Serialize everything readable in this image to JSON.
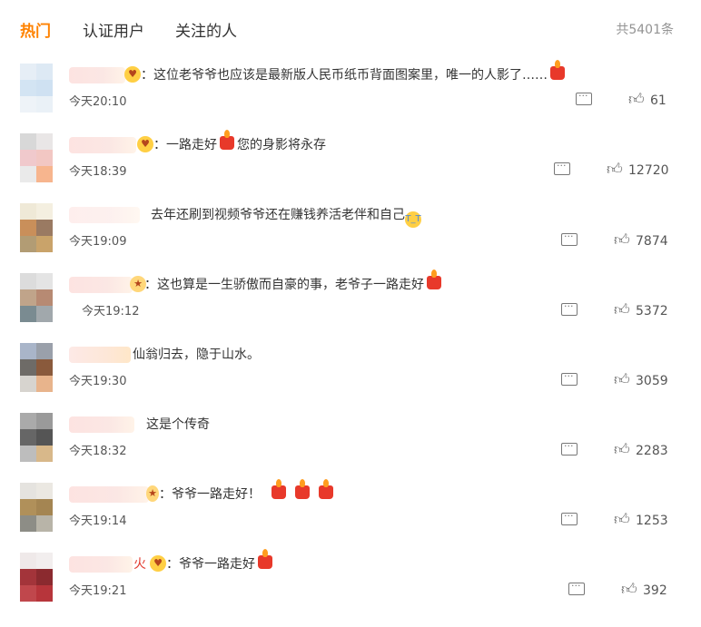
{
  "tabs": [
    {
      "label": "热门",
      "active": true
    },
    {
      "label": "认证用户",
      "active": false
    },
    {
      "label": "关注的人",
      "active": false
    }
  ],
  "total": "共5401条",
  "comments": [
    {
      "text": "：这位老爷爷也应该是最新版人民币纸币背面图案里，唯一的人影了……",
      "time": "今天20:10",
      "likes": "61"
    },
    {
      "text_a": "：一路走好",
      "text_b": "您的身影将永存",
      "time": "今天18:39",
      "likes": "12720"
    },
    {
      "text": "去年还刷到视频爷爷还在赚钱养活老伴和自己",
      "time": "今天19:09",
      "likes": "7874"
    },
    {
      "text": "：这也算是一生骄傲而自豪的事，老爷子一路走好",
      "time": "今天19:12",
      "likes": "5372"
    },
    {
      "text": "仙翁归去，隐于山水。",
      "time": "今天19:30",
      "likes": "3059"
    },
    {
      "text": "这是个传奇",
      "time": "今天18:32",
      "likes": "2283"
    },
    {
      "text": "：爷爷一路走好！",
      "time": "今天19:14",
      "likes": "1253"
    },
    {
      "name_tail": "火",
      "text": "：爷爷一路走好",
      "time": "今天19:21",
      "likes": "392"
    }
  ],
  "icons": {
    "reply": "comment-bubble-icon",
    "like": "thumbs-up-icon",
    "candle": "candle-emoji",
    "crying": "crying-emoji"
  },
  "colors": {
    "accent": "#ff8200",
    "muted": "#939393"
  }
}
